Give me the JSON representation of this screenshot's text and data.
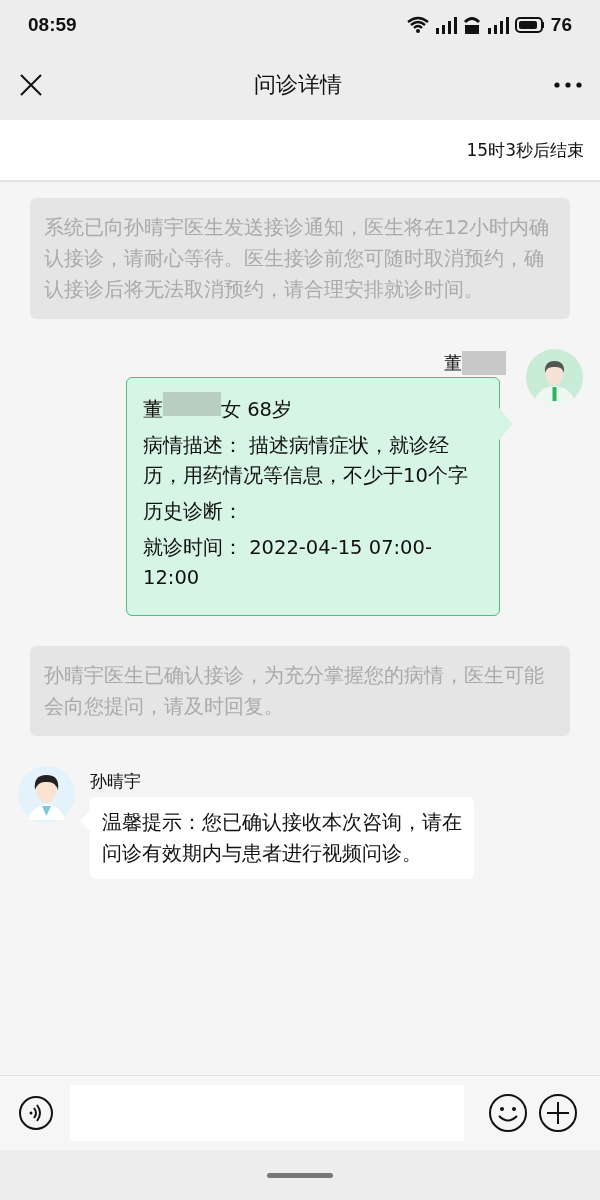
{
  "status_bar": {
    "time": "08:59",
    "battery": "76"
  },
  "nav": {
    "title": "问诊详情"
  },
  "countdown": "15时3秒后结束",
  "messages": [
    {
      "kind": "system",
      "text": "系统已向孙晴宇医生发送接诊通知，医生将在12小时内确认接诊，请耐心等待。医生接诊前您可随时取消预约，确认接诊后将无法取消预约，请合理安排就诊时间。"
    },
    {
      "kind": "patient_card",
      "sender": "董",
      "patient_name": "董",
      "patient_info": "女 68岁",
      "fields": [
        {
          "label": "病情描述：",
          "value": "描述病情症状，就诊经历，用药情况等信息，不少于10个字"
        },
        {
          "label": "历史诊断："
        },
        {
          "label": "就诊时间：",
          "value": "2022-04-15 07:00- 12:00"
        }
      ]
    },
    {
      "kind": "system",
      "text": "孙晴宇医生已确认接诊，为充分掌握您的病情，医生可能会向您提问，请及时回复。"
    },
    {
      "kind": "doctor",
      "sender": "孙晴宇",
      "text": "温馨提示：您已确认接收本次咨询，请在问诊有效期内与患者进行视频问诊。"
    }
  ]
}
